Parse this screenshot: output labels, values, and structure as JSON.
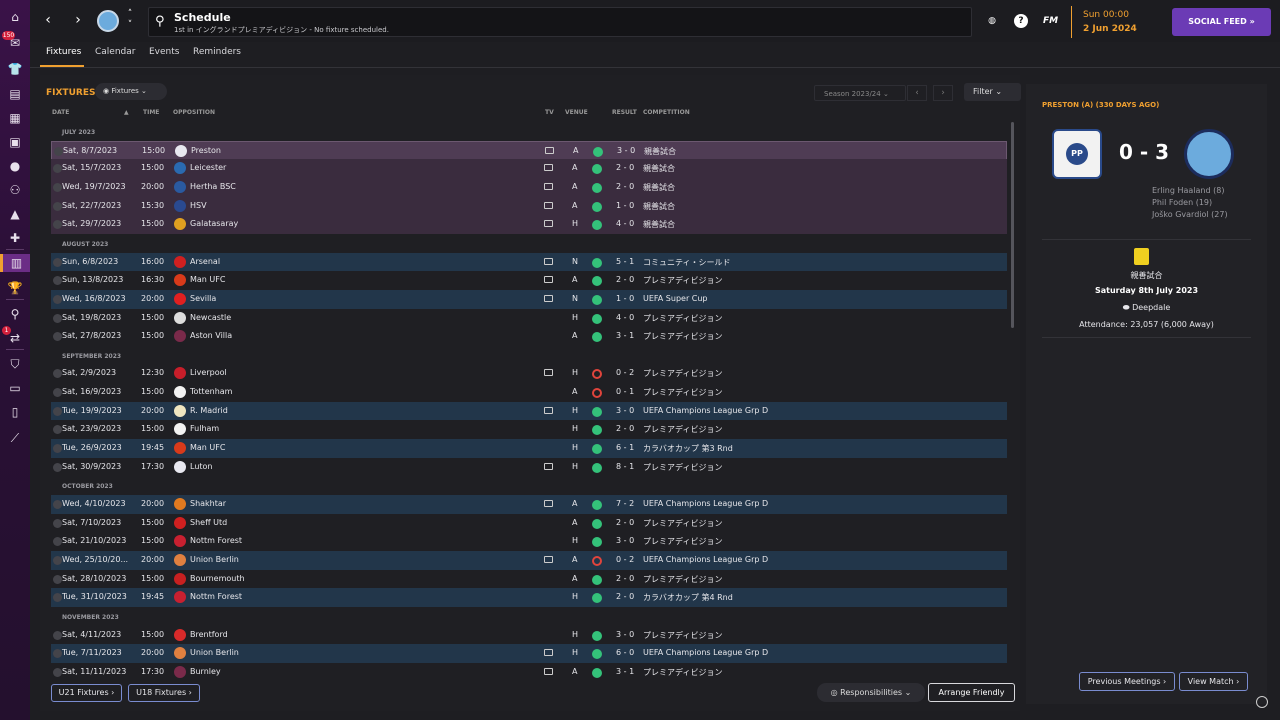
{
  "app": {
    "title": "Schedule",
    "subtitle": "1st in イングランドプレミアディビジョン - No fixture scheduled.",
    "brand": "FM",
    "date_time": "Sun 00:00",
    "date": "2 Jun 2024",
    "social_label": "SOCIAL FEED",
    "accent": "#f0a030",
    "social_color": "#6b3bb5"
  },
  "rail": {
    "inbox_badge": "150",
    "notice_badge": "1"
  },
  "tabs": [
    "Fixtures",
    "Calendar",
    "Events",
    "Reminders"
  ],
  "main": {
    "section_title": "FIXTURES",
    "view_dropdown": "Fixtures",
    "season": "Season 2023/24",
    "filter_label": "Filter",
    "columns": {
      "date": "DATE",
      "time": "TIME",
      "opposition": "OPPOSITION",
      "tv": "TV",
      "venue": "VENUE",
      "result": "RESULT",
      "competition": "COMPETITION"
    },
    "rows": [
      {
        "kind": "month",
        "label": "JULY 2023"
      },
      {
        "kind": "match",
        "style": "sel",
        "date": "Sat, 8/7/2023",
        "time": "15:00",
        "opp": "Preston",
        "badge": "#e8e8f0",
        "tv": true,
        "venue": "A",
        "res": "w",
        "score": "3 - 0",
        "comp": "親善試合"
      },
      {
        "kind": "match",
        "style": "purple",
        "date": "Sat, 15/7/2023",
        "time": "15:00",
        "opp": "Leicester",
        "badge": "#2a6ab0",
        "tv": true,
        "venue": "A",
        "res": "w",
        "score": "2 - 0",
        "comp": "親善試合"
      },
      {
        "kind": "match",
        "style": "purple",
        "date": "Wed, 19/7/2023",
        "time": "20:00",
        "opp": "Hertha BSC",
        "badge": "#2a5aa0",
        "tv": true,
        "venue": "A",
        "res": "w",
        "score": "2 - 0",
        "comp": "親善試合"
      },
      {
        "kind": "match",
        "style": "purple",
        "date": "Sat, 22/7/2023",
        "time": "15:30",
        "opp": "HSV",
        "badge": "#2a4a90",
        "tv": true,
        "venue": "A",
        "res": "w",
        "score": "1 - 0",
        "comp": "親善試合"
      },
      {
        "kind": "match",
        "style": "purple",
        "date": "Sat, 29/7/2023",
        "time": "15:00",
        "opp": "Galatasaray",
        "badge": "#e0a020",
        "tv": true,
        "venue": "H",
        "res": "w",
        "score": "4 - 0",
        "comp": "親善試合"
      },
      {
        "kind": "month",
        "label": "AUGUST 2023"
      },
      {
        "kind": "match",
        "style": "blue",
        "date": "Sun, 6/8/2023",
        "time": "16:00",
        "opp": "Arsenal",
        "badge": "#d02020",
        "tv": true,
        "venue": "N",
        "res": "w",
        "score": "5 - 1",
        "comp": "コミュニティ・シールド"
      },
      {
        "kind": "match",
        "style": "plain",
        "date": "Sun, 13/8/2023",
        "time": "16:30",
        "opp": "Man UFC",
        "badge": "#d83a1a",
        "tv": true,
        "venue": "A",
        "res": "w",
        "score": "2 - 0",
        "comp": "プレミアディビジョン"
      },
      {
        "kind": "match",
        "style": "blue",
        "date": "Wed, 16/8/2023",
        "time": "20:00",
        "opp": "Sevilla",
        "badge": "#e02020",
        "tv": true,
        "venue": "N",
        "res": "w",
        "score": "1 - 0",
        "comp": "UEFA Super Cup"
      },
      {
        "kind": "match",
        "style": "plain",
        "date": "Sat, 19/8/2023",
        "time": "15:00",
        "opp": "Newcastle",
        "badge": "#dddddd",
        "tv": false,
        "venue": "H",
        "res": "w",
        "score": "4 - 0",
        "comp": "プレミアディビジョン"
      },
      {
        "kind": "match",
        "style": "plain",
        "date": "Sat, 27/8/2023",
        "time": "15:00",
        "opp": "Aston Villa",
        "badge": "#7a2a4a",
        "tv": false,
        "venue": "A",
        "res": "w",
        "score": "3 - 1",
        "comp": "プレミアディビジョン"
      },
      {
        "kind": "month",
        "label": "SEPTEMBER 2023"
      },
      {
        "kind": "match",
        "style": "plain",
        "date": "Sat, 2/9/2023",
        "time": "12:30",
        "opp": "Liverpool",
        "badge": "#c81e2a",
        "tv": true,
        "venue": "H",
        "res": "l",
        "score": "0 - 2",
        "comp": "プレミアディビジョン"
      },
      {
        "kind": "match",
        "style": "plain",
        "date": "Sat, 16/9/2023",
        "time": "15:00",
        "opp": "Tottenham",
        "badge": "#f2f2f2",
        "tv": false,
        "venue": "A",
        "res": "l",
        "score": "0 - 1",
        "comp": "プレミアディビジョン"
      },
      {
        "kind": "match",
        "style": "blue",
        "date": "Tue, 19/9/2023",
        "time": "20:00",
        "opp": "R. Madrid",
        "badge": "#f0e6c0",
        "tv": true,
        "venue": "H",
        "res": "w",
        "score": "3 - 0",
        "comp": "UEFA Champions League Grp D"
      },
      {
        "kind": "match",
        "style": "plain",
        "date": "Sat, 23/9/2023",
        "time": "15:00",
        "opp": "Fulham",
        "badge": "#f2f2f2",
        "tv": false,
        "venue": "H",
        "res": "w",
        "score": "2 - 0",
        "comp": "プレミアディビジョン"
      },
      {
        "kind": "match",
        "style": "blue",
        "date": "Tue, 26/9/2023",
        "time": "19:45",
        "opp": "Man UFC",
        "badge": "#d83a1a",
        "tv": false,
        "venue": "H",
        "res": "w",
        "score": "6 - 1",
        "comp": "カラバオカップ 第3 Rnd"
      },
      {
        "kind": "match",
        "style": "plain",
        "date": "Sat, 30/9/2023",
        "time": "17:30",
        "opp": "Luton",
        "badge": "#e8e8f0",
        "tv": true,
        "venue": "H",
        "res": "w",
        "score": "8 - 1",
        "comp": "プレミアディビジョン"
      },
      {
        "kind": "month",
        "label": "OCTOBER 2023"
      },
      {
        "kind": "match",
        "style": "blue",
        "date": "Wed, 4/10/2023",
        "time": "20:00",
        "opp": "Shakhtar",
        "badge": "#e07a20",
        "tv": true,
        "venue": "A",
        "res": "w",
        "score": "7 - 2",
        "comp": "UEFA Champions League Grp D"
      },
      {
        "kind": "match",
        "style": "plain",
        "date": "Sat, 7/10/2023",
        "time": "15:00",
        "opp": "Sheff Utd",
        "badge": "#d02020",
        "tv": false,
        "venue": "A",
        "res": "w",
        "score": "2 - 0",
        "comp": "プレミアディビジョン"
      },
      {
        "kind": "match",
        "style": "plain",
        "date": "Sat, 21/10/2023",
        "time": "15:00",
        "opp": "Nottm Forest",
        "badge": "#c82030",
        "tv": false,
        "venue": "H",
        "res": "w",
        "score": "3 - 0",
        "comp": "プレミアディビジョン"
      },
      {
        "kind": "match",
        "style": "blue",
        "date": "Wed, 25/10/20...",
        "time": "20:00",
        "opp": "Union Berlin",
        "badge": "#e08040",
        "tv": true,
        "venue": "A",
        "res": "l",
        "score": "0 - 2",
        "comp": "UEFA Champions League Grp D"
      },
      {
        "kind": "match",
        "style": "plain",
        "date": "Sat, 28/10/2023",
        "time": "15:00",
        "opp": "Bournemouth",
        "badge": "#c82020",
        "tv": false,
        "venue": "A",
        "res": "w",
        "score": "2 - 0",
        "comp": "プレミアディビジョン"
      },
      {
        "kind": "match",
        "style": "blue",
        "date": "Tue, 31/10/2023",
        "time": "19:45",
        "opp": "Nottm Forest",
        "badge": "#c82030",
        "tv": false,
        "venue": "H",
        "res": "w",
        "score": "2 - 0",
        "comp": "カラバオカップ 第4 Rnd"
      },
      {
        "kind": "month",
        "label": "NOVEMBER 2023"
      },
      {
        "kind": "match",
        "style": "plain",
        "date": "Sat, 4/11/2023",
        "time": "15:00",
        "opp": "Brentford",
        "badge": "#d82a2a",
        "tv": false,
        "venue": "H",
        "res": "w",
        "score": "3 - 0",
        "comp": "プレミアディビジョン"
      },
      {
        "kind": "match",
        "style": "blue",
        "date": "Tue, 7/11/2023",
        "time": "20:00",
        "opp": "Union Berlin",
        "badge": "#e08040",
        "tv": true,
        "venue": "H",
        "res": "w",
        "score": "6 - 0",
        "comp": "UEFA Champions League Grp D"
      },
      {
        "kind": "match",
        "style": "plain",
        "date": "Sat, 11/11/2023",
        "time": "17:30",
        "opp": "Burnley",
        "badge": "#7a2a4a",
        "tv": true,
        "venue": "A",
        "res": "w",
        "score": "3 - 1",
        "comp": "プレミアディビジョン"
      }
    ],
    "u21_label": "U21 Fixtures",
    "u18_label": "U18 Fixtures",
    "responsibilities_label": "Responsibilities",
    "arrange_label": "Arrange Friendly"
  },
  "detail": {
    "title": "PRESTON (A) (330 DAYS AGO)",
    "home_crest_text": "PP",
    "score": "0 - 3",
    "scorers": [
      "Erling Haaland (8)",
      "Phil Foden (19)",
      "Joško Gvardiol (27)"
    ],
    "competition": "親善試合",
    "match_date": "Saturday 8th July 2023",
    "stadium": "Deepdale",
    "attendance": "Attendance: 23,057 (6,000 Away)",
    "prev_label": "Previous Meetings",
    "view_label": "View Match"
  }
}
